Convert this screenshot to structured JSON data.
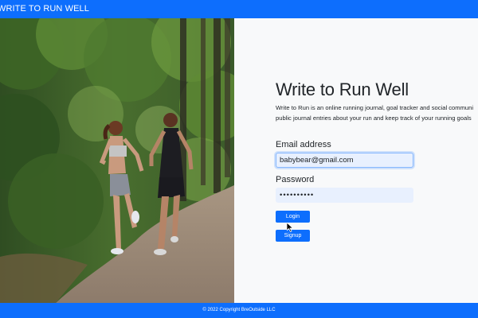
{
  "navbar": {
    "brand": "WRITE TO RUN WELL"
  },
  "hero": {
    "image": "two-women-trail-running-photo"
  },
  "main": {
    "title": "Write to Run Well",
    "description_line1": "Write to Run is an online running journal, goal tracker and social communi",
    "description_line2": "public journal entries about your run and keep track of your running goals"
  },
  "form": {
    "email_label": "Email address",
    "email_value": "babybear@gmail.com",
    "password_label": "Password",
    "password_value": "••••••••••",
    "login_label": "Login",
    "signup_label": "Signup"
  },
  "footer": {
    "text": "© 2022 Copyright BreOutside LLC"
  },
  "colors": {
    "primary": "#0d6efd",
    "background": "#f8f9fa",
    "autofill": "#e8f0fe"
  }
}
